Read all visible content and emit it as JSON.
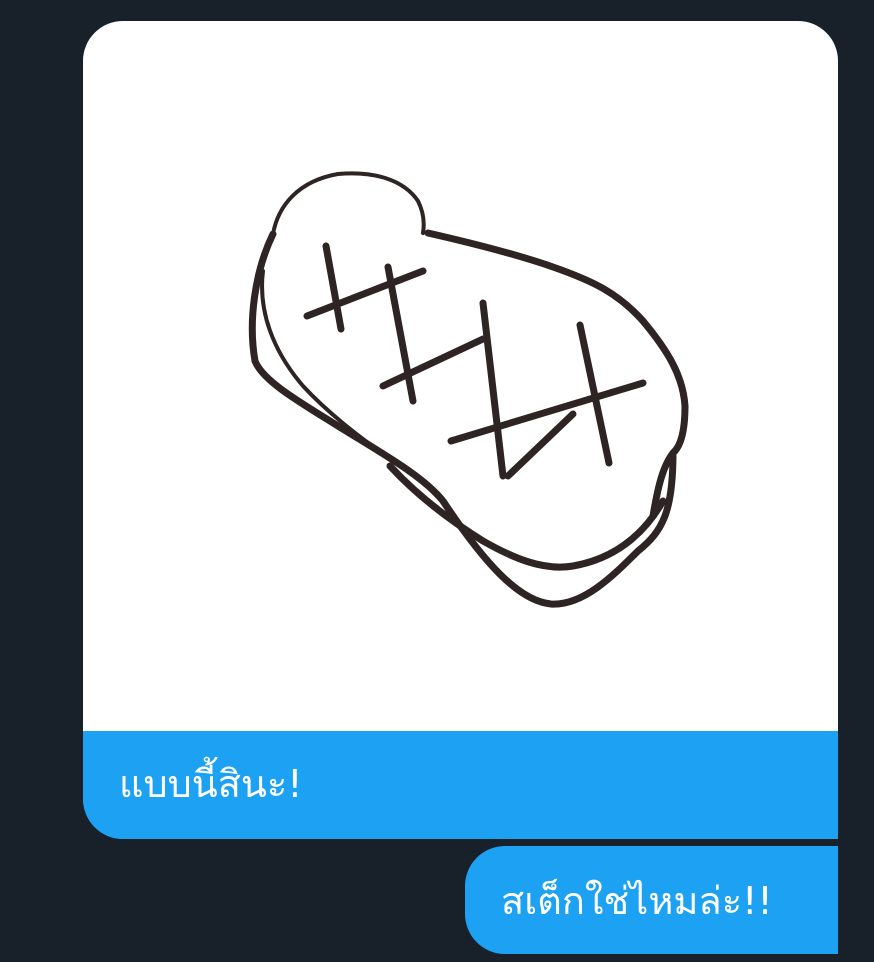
{
  "conversation": {
    "messages": [
      {
        "type": "image",
        "image_alt": "",
        "caption": "แบบนี้สินะ!"
      },
      {
        "type": "text",
        "text": "สเต็กใช่ไหมล่ะ!!"
      }
    ]
  },
  "colors": {
    "background": "#18202a",
    "bubble": "#1da1f2",
    "bubble_text": "#ffffff",
    "image_background": "#ffffff",
    "drawing_stroke": "#2f2424"
  },
  "icons": {
    "drawing": "steak-drawing"
  }
}
